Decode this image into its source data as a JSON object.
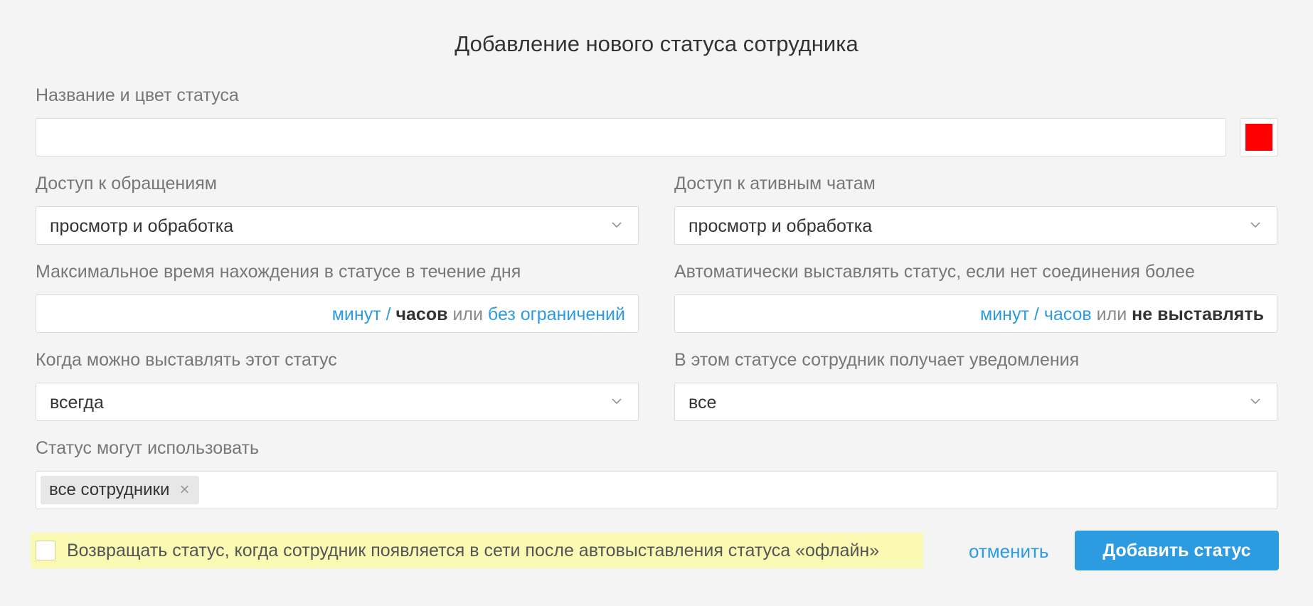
{
  "dialog": {
    "title": "Добавление нового статуса сотрудника"
  },
  "name_field": {
    "label": "Название и цвет статуса",
    "value": "",
    "color": "#ff0000"
  },
  "requests_access": {
    "label": "Доступ к обращениям",
    "value": "просмотр и обработка"
  },
  "chats_access": {
    "label": "Доступ к ативным чатам",
    "value": "просмотр и обработка"
  },
  "max_time": {
    "label": "Максимальное время нахождения в статусе в течение дня",
    "value": "",
    "minutes": "минут",
    "slash": "/",
    "hours": "часов",
    "or": "или",
    "no_limit": "без ограничений"
  },
  "auto_status": {
    "label": "Автоматически выставлять статус, если нет соединения более",
    "value": "",
    "minutes": "минут",
    "slash": "/",
    "hours": "часов",
    "or": "или",
    "dont_set": "не выставлять"
  },
  "when_set": {
    "label": "Когда можно выставлять этот статус",
    "value": "всегда"
  },
  "notifications": {
    "label": "В этом статусе сотрудник получает уведомления",
    "value": "все"
  },
  "users": {
    "label": "Статус могут использовать",
    "tags": [
      "все сотрудники"
    ],
    "remove_glyph": "×"
  },
  "return_status": {
    "label": "Возвращать статус, когда сотрудник появляется в сети после автовыставления статуса «офлайн»",
    "checked": false
  },
  "actions": {
    "cancel": "отменить",
    "submit": "Добавить статус"
  },
  "colors": {
    "accent": "#2d9be0",
    "highlight": "#fafab4",
    "status_color": "#ff0000"
  }
}
